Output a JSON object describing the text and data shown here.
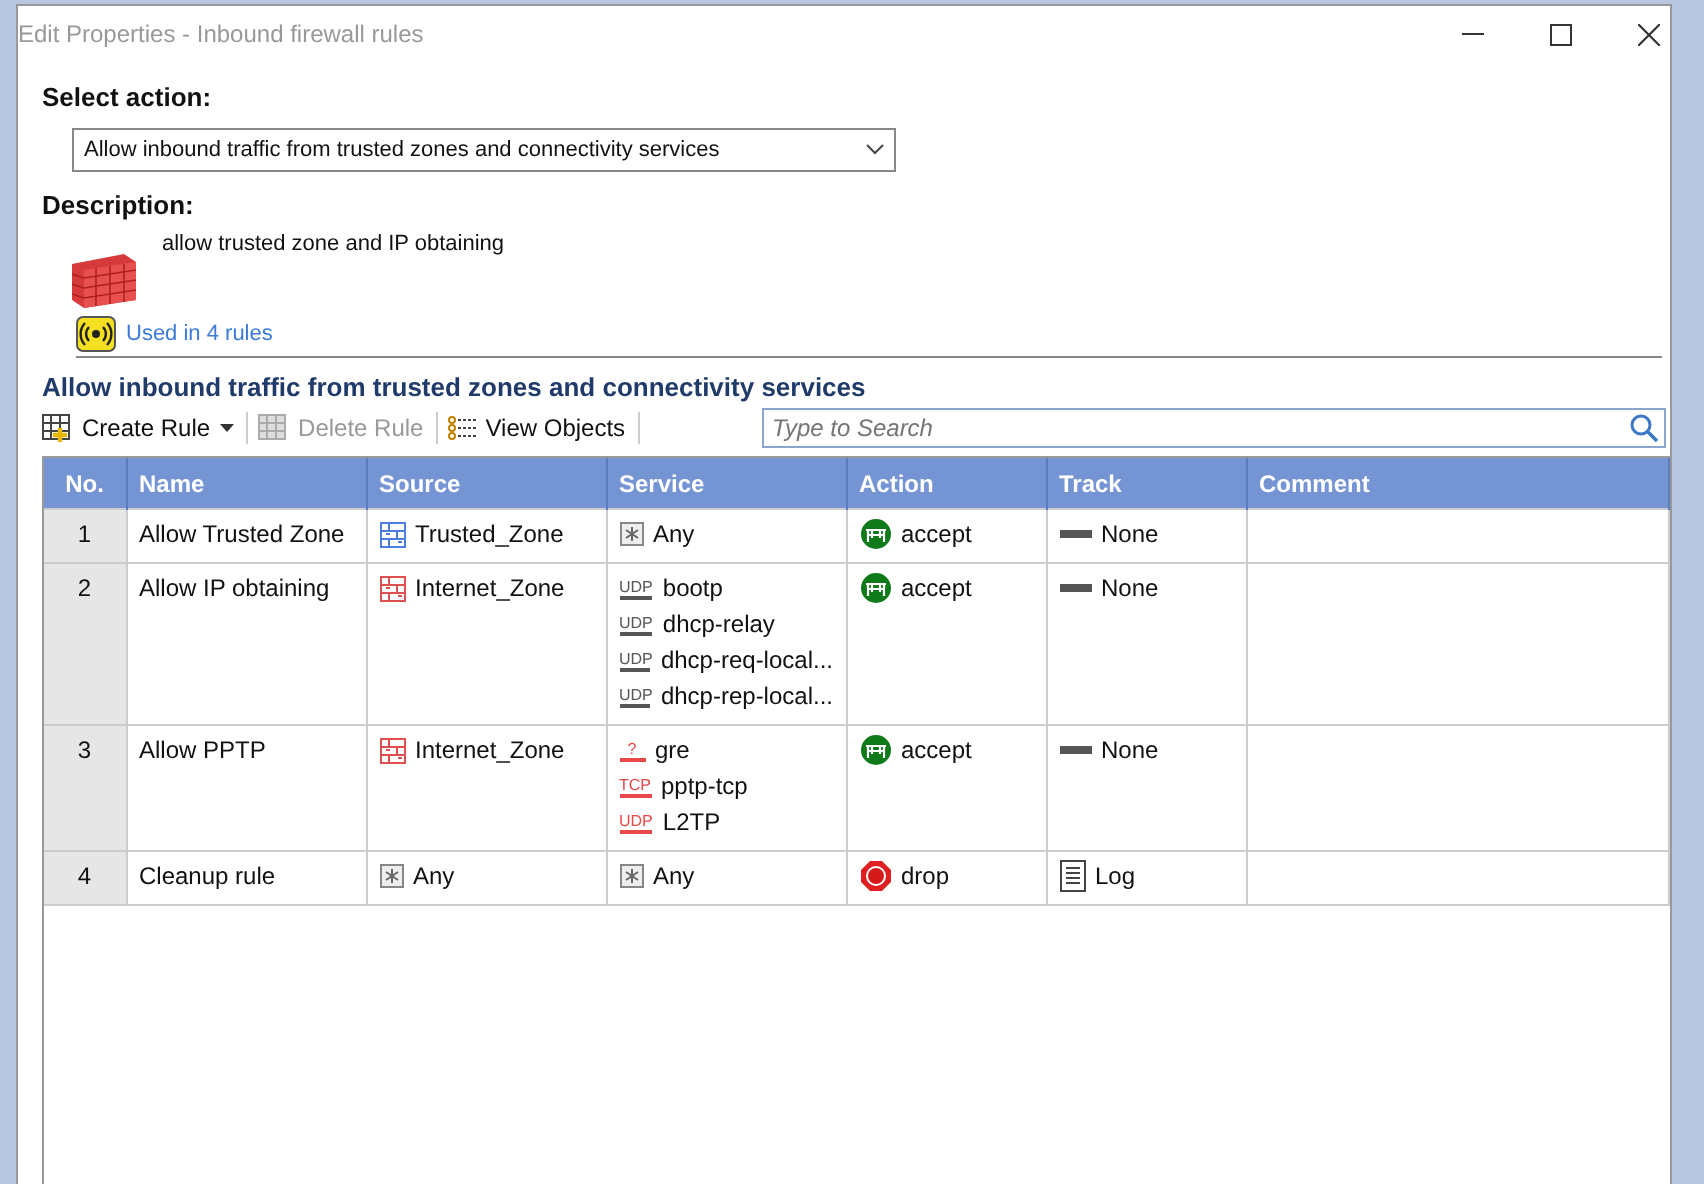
{
  "window": {
    "title": "Edit Properties - Inbound firewall rules"
  },
  "select_action": {
    "label": "Select action:",
    "value": "Allow inbound traffic from trusted zones and connectivity services"
  },
  "description": {
    "label": "Description:",
    "text": "allow trusted zone and IP obtaining",
    "usage_link": "Used in 4 rules"
  },
  "section_title": "Allow inbound traffic from trusted zones and connectivity services",
  "toolbar": [
    {
      "kind": "create",
      "label": "Create Rule",
      "disabled": false,
      "dropdown": true
    },
    {
      "kind": "delete",
      "label": "Delete Rule",
      "disabled": true,
      "dropdown": false
    },
    {
      "kind": "objects",
      "label": "View Objects",
      "disabled": false,
      "dropdown": false
    }
  ],
  "search": {
    "placeholder": "Type to Search"
  },
  "table": {
    "columns": [
      "No.",
      "Name",
      "Source",
      "Service",
      "Action",
      "Track",
      "Comment"
    ],
    "rows": [
      {
        "no": "1",
        "name": "Allow Trusted Zone",
        "source": [
          {
            "kind": "zone",
            "label": "Trusted_Zone",
            "color": "#4a7fe0"
          }
        ],
        "service": [
          {
            "kind": "any",
            "label": "Any"
          }
        ],
        "action": {
          "kind": "accept",
          "label": "accept"
        },
        "track": {
          "kind": "none",
          "label": "None"
        }
      },
      {
        "no": "2",
        "name": "Allow IP obtaining",
        "source": [
          {
            "kind": "zone",
            "label": "Internet_Zone",
            "color": "#e05050"
          }
        ],
        "service": [
          {
            "kind": "protocol",
            "protocol": "UDP",
            "label": "bootp",
            "color": "#555555"
          },
          {
            "kind": "protocol",
            "protocol": "UDP",
            "label": "dhcp-relay",
            "color": "#555555"
          },
          {
            "kind": "protocol",
            "protocol": "UDP",
            "label": "dhcp-req-local...",
            "color": "#555555"
          },
          {
            "kind": "protocol",
            "protocol": "UDP",
            "label": "dhcp-rep-local...",
            "color": "#555555"
          }
        ],
        "action": {
          "kind": "accept",
          "label": "accept"
        },
        "track": {
          "kind": "none",
          "label": "None"
        }
      },
      {
        "no": "3",
        "name": "Allow PPTP",
        "source": [
          {
            "kind": "zone",
            "label": "Internet_Zone",
            "color": "#e05050"
          }
        ],
        "service": [
          {
            "kind": "protocol",
            "protocol": "?",
            "label": "gre",
            "color": "#e84848"
          },
          {
            "kind": "protocol",
            "protocol": "TCP",
            "label": "pptp-tcp",
            "color": "#e84848"
          },
          {
            "kind": "protocol",
            "protocol": "UDP",
            "label": "L2TP",
            "color": "#e84848"
          }
        ],
        "action": {
          "kind": "accept",
          "label": "accept"
        },
        "track": {
          "kind": "none",
          "label": "None"
        }
      },
      {
        "no": "4",
        "name": "Cleanup rule",
        "source": [
          {
            "kind": "any",
            "label": "Any"
          }
        ],
        "service": [
          {
            "kind": "any",
            "label": "Any"
          }
        ],
        "action": {
          "kind": "drop",
          "label": "drop"
        },
        "track": {
          "kind": "log",
          "label": "Log"
        }
      }
    ]
  }
}
